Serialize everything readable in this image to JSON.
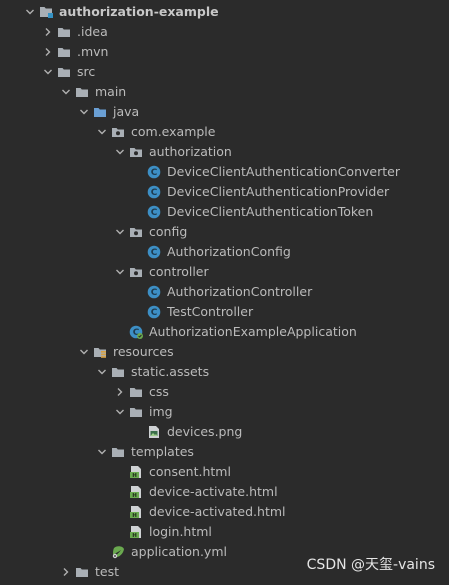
{
  "tree": [
    {
      "label": "authorization-example",
      "depth": 0,
      "arrow": "down",
      "icon": "module-folder-icon",
      "bold": true
    },
    {
      "label": ".idea",
      "depth": 1,
      "arrow": "right",
      "icon": "folder-icon"
    },
    {
      "label": ".mvn",
      "depth": 1,
      "arrow": "right",
      "icon": "folder-icon"
    },
    {
      "label": "src",
      "depth": 1,
      "arrow": "down",
      "icon": "folder-icon"
    },
    {
      "label": "main",
      "depth": 2,
      "arrow": "down",
      "icon": "folder-icon"
    },
    {
      "label": "java",
      "depth": 3,
      "arrow": "down",
      "icon": "source-folder-icon"
    },
    {
      "label": "com.example",
      "depth": 4,
      "arrow": "down",
      "icon": "package-icon"
    },
    {
      "label": "authorization",
      "depth": 5,
      "arrow": "down",
      "icon": "package-icon"
    },
    {
      "label": "DeviceClientAuthenticationConverter",
      "depth": 6,
      "arrow": "none",
      "icon": "class-icon"
    },
    {
      "label": "DeviceClientAuthenticationProvider",
      "depth": 6,
      "arrow": "none",
      "icon": "class-icon"
    },
    {
      "label": "DeviceClientAuthenticationToken",
      "depth": 6,
      "arrow": "none",
      "icon": "class-icon"
    },
    {
      "label": "config",
      "depth": 5,
      "arrow": "down",
      "icon": "package-icon"
    },
    {
      "label": "AuthorizationConfig",
      "depth": 6,
      "arrow": "none",
      "icon": "class-icon"
    },
    {
      "label": "controller",
      "depth": 5,
      "arrow": "down",
      "icon": "package-icon"
    },
    {
      "label": "AuthorizationController",
      "depth": 6,
      "arrow": "none",
      "icon": "class-icon"
    },
    {
      "label": "TestController",
      "depth": 6,
      "arrow": "none",
      "icon": "class-icon"
    },
    {
      "label": "AuthorizationExampleApplication",
      "depth": 5,
      "arrow": "none",
      "icon": "spring-boot-class-icon"
    },
    {
      "label": "resources",
      "depth": 3,
      "arrow": "down",
      "icon": "resources-folder-icon"
    },
    {
      "label": "static.assets",
      "depth": 4,
      "arrow": "down",
      "icon": "folder-icon"
    },
    {
      "label": "css",
      "depth": 5,
      "arrow": "right",
      "icon": "folder-icon"
    },
    {
      "label": "img",
      "depth": 5,
      "arrow": "down",
      "icon": "folder-icon"
    },
    {
      "label": "devices.png",
      "depth": 6,
      "arrow": "none",
      "icon": "image-file-icon"
    },
    {
      "label": "templates",
      "depth": 4,
      "arrow": "down",
      "icon": "folder-icon"
    },
    {
      "label": "consent.html",
      "depth": 5,
      "arrow": "none",
      "icon": "html-file-icon"
    },
    {
      "label": "device-activate.html",
      "depth": 5,
      "arrow": "none",
      "icon": "html-file-icon"
    },
    {
      "label": "device-activated.html",
      "depth": 5,
      "arrow": "none",
      "icon": "html-file-icon"
    },
    {
      "label": "login.html",
      "depth": 5,
      "arrow": "none",
      "icon": "html-file-icon"
    },
    {
      "label": "application.yml",
      "depth": 4,
      "arrow": "none",
      "icon": "yaml-config-icon"
    },
    {
      "label": "test",
      "depth": 2,
      "arrow": "right",
      "icon": "folder-icon"
    }
  ],
  "watermark": "CSDN @天玺-vains",
  "colors": {
    "background": "#2b2b2b",
    "text": "#bbbbbb",
    "folder": "#a9afb5",
    "source_folder": "#6a9fd4",
    "class": "#3d8fc5",
    "html": "#6aa94f",
    "module_marker": "#3592c4"
  }
}
